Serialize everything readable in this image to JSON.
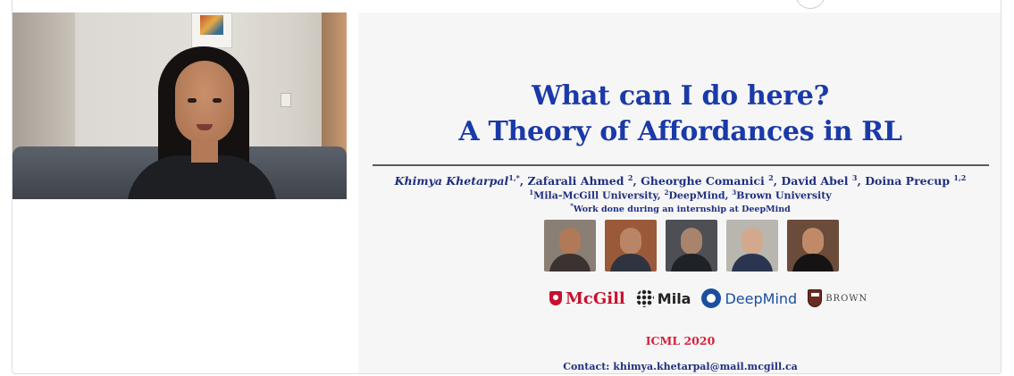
{
  "slide": {
    "title_line1": "What can I do here?",
    "title_line2": "A Theory of Affordances in RL",
    "authors": {
      "lead_name": "Khimya Khetarpal",
      "lead_sup": "1,*",
      "rest": [
        {
          "name": "Zafarali Ahmed",
          "sup": "2"
        },
        {
          "name": "Gheorghe Comanici",
          "sup": "2"
        },
        {
          "name": "David Abel",
          "sup": "3"
        },
        {
          "name": "Doina Precup",
          "sup": "1,2"
        }
      ]
    },
    "affiliations": [
      {
        "sup": "1",
        "name": "Mila-McGill University,"
      },
      {
        "sup": "2",
        "name": "DeepMind,"
      },
      {
        "sup": "3",
        "name": "Brown University"
      }
    ],
    "note_sup": "*",
    "note": "Work done during an internship at DeepMind",
    "logos": {
      "mcgill": "McGill",
      "mila": "Mila",
      "deepmind": "DeepMind",
      "brown": "BROWN"
    },
    "conference": "ICML 2020",
    "contact_label": "Contact:",
    "contact_email": "khimya.khetarpal@mail.mcgill.ca"
  },
  "colors": {
    "title": "#1a3aa8",
    "authors": "#1e2f80",
    "conference": "#d4213d",
    "mcgill_red": "#c8102e",
    "deepmind_blue": "#1a4fa0"
  }
}
